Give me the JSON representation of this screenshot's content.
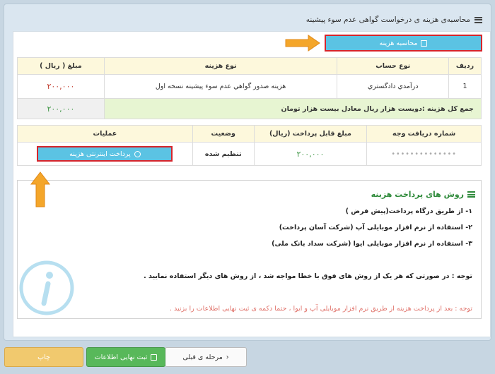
{
  "page": {
    "title": "محاسبه‌ی هزینه ی درخواست گواهی عدم سوء پیشینه"
  },
  "calc_button": {
    "label": "محاسبه هزینه"
  },
  "costs_table": {
    "headers": [
      "ردیف",
      "نوع حساب",
      "نوع هزینه",
      "مبلغ ( ریال )"
    ],
    "rows": [
      {
        "row": "1",
        "account": "درآمدي دادگستري",
        "cost_type": "هزينه صدور گواهي عدم سوء پيشينه نسخه اول",
        "amount": "۲۰۰,۰۰۰"
      }
    ],
    "total_label": "جمع کل هزینه :دویست هزار ریال معادل بیست هزار تومان",
    "total_amount": "۲۰۰,۰۰۰"
  },
  "payment_table": {
    "headers": [
      "شماره دریافت وجه",
      "مبلغ قابل پرداخت (ریال)",
      "وضعیت",
      "عملیات"
    ],
    "row": {
      "receipt_no": "••••••••••••••",
      "amount": "۲۰۰,۰۰۰",
      "status": "تنظیم شده",
      "action_label": "پرداخت اینترنتی هزینه"
    }
  },
  "methods": {
    "title": "روش های پرداخت هزینه",
    "items": [
      "۱- از طریق درگاه پرداخت(پیش فرض )",
      "۲- استفاده از نرم افزار موبایلی آپ (شرکت آسان پرداخت)",
      "۳- استفاده از نرم افزار موبایلی ایوا (شرکت سداد بانک ملی)"
    ],
    "note": "توجه : در صورتی که هر یک از روش های فوق با خطا مواجه شد ، از روش های دیگر استفاده نمایید .",
    "note2": "توجه : بعد از پرداخت هزینه از طریق نرم افزار موبایلی آپ و ایوا ، حتما دکمه ی ثبت نهایی اطلاعات را بزنید ."
  },
  "footer": {
    "prev_label": "مرحله ی قبلی",
    "submit_label": "ثبت نهایی اطلاعات",
    "print_label": "چاپ"
  },
  "colors": {
    "accent_button": "#5bc3e3",
    "highlight_border": "#d6242b",
    "amount_red": "#c0392b",
    "amount_green": "#3f9645",
    "arrow_orange": "#f4a62a"
  }
}
